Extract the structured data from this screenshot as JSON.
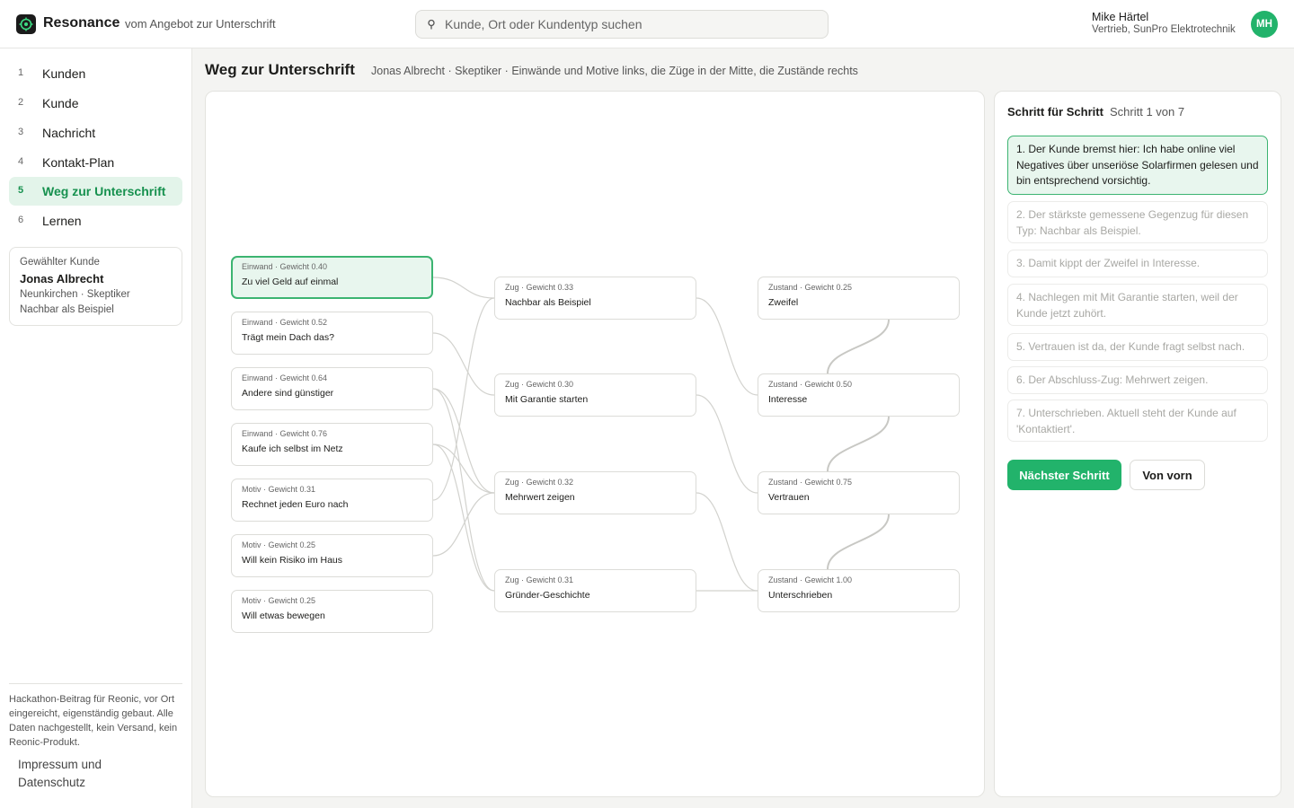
{
  "header": {
    "brand": "Resonance",
    "tagline": "vom Angebot zur Unterschrift",
    "search_placeholder": "Kunde, Ort oder Kundentyp suchen",
    "user_name": "Mike Härtel",
    "user_role": "Vertrieb, SunPro Elektrotechnik",
    "avatar_initials": "MH"
  },
  "sidebar": {
    "items": [
      {
        "num": "1",
        "label": "Kunden"
      },
      {
        "num": "2",
        "label": "Kunde"
      },
      {
        "num": "3",
        "label": "Nachricht"
      },
      {
        "num": "4",
        "label": "Kontakt-Plan"
      },
      {
        "num": "5",
        "label": "Weg zur Unterschrift",
        "active": true
      },
      {
        "num": "6",
        "label": "Lernen"
      }
    ],
    "customer_card": {
      "title": "Gewählter Kunde",
      "name": "Jonas Albrecht",
      "line1": "Neunkirchen · Skeptiker",
      "line2": "Nachbar als Beispiel"
    },
    "footer_note": "Hackathon-Beitrag für Reonic, vor Ort eingereicht, eigenständig gebaut. Alle Daten nachgestellt, kein Versand, kein Reonic-Produkt.",
    "imprint": "Impressum und Datenschutz"
  },
  "main": {
    "title": "Weg zur Unterschrift",
    "subtitle": "Jonas Albrecht · Skeptiker · Einwände und Motive links, die Züge in der Mitte, die Zustände rechts"
  },
  "graph": {
    "columns": [
      [
        {
          "id": "e1",
          "meta": "Einwand · Gewicht 0.40",
          "label": "Zu viel Geld auf einmal",
          "active": true
        },
        {
          "id": "e2",
          "meta": "Einwand · Gewicht 0.52",
          "label": "Trägt mein Dach das?"
        },
        {
          "id": "e3",
          "meta": "Einwand · Gewicht 0.64",
          "label": "Andere sind günstiger"
        },
        {
          "id": "e4",
          "meta": "Einwand · Gewicht 0.76",
          "label": "Kaufe ich selbst im Netz"
        },
        {
          "id": "m1",
          "meta": "Motiv · Gewicht 0.31",
          "label": "Rechnet jeden Euro nach"
        },
        {
          "id": "m2",
          "meta": "Motiv · Gewicht 0.25",
          "label": "Will kein Risiko im Haus"
        },
        {
          "id": "m3",
          "meta": "Motiv · Gewicht 0.25",
          "label": "Will etwas bewegen"
        }
      ],
      [
        {
          "id": "z1",
          "meta": "Zug · Gewicht 0.33",
          "label": "Nachbar als Beispiel"
        },
        {
          "id": "z2",
          "meta": "Zug · Gewicht 0.30",
          "label": "Mit Garantie starten"
        },
        {
          "id": "z3",
          "meta": "Zug · Gewicht 0.32",
          "label": "Mehrwert zeigen"
        },
        {
          "id": "z4",
          "meta": "Zug · Gewicht 0.31",
          "label": "Gründer-Geschichte"
        }
      ],
      [
        {
          "id": "s1",
          "meta": "Zustand · Gewicht 0.25",
          "label": "Zweifel"
        },
        {
          "id": "s2",
          "meta": "Zustand · Gewicht 0.50",
          "label": "Interesse"
        },
        {
          "id": "s3",
          "meta": "Zustand · Gewicht 0.75",
          "label": "Vertrauen"
        },
        {
          "id": "s4",
          "meta": "Zustand · Gewicht 1.00",
          "label": "Unterschrieben"
        }
      ]
    ],
    "edges": [
      [
        "e1",
        "z1"
      ],
      [
        "e2",
        "z2"
      ],
      [
        "e3",
        "z3"
      ],
      [
        "e4",
        "z4"
      ],
      [
        "m1",
        "z1"
      ],
      [
        "m2",
        "z3"
      ],
      [
        "e3",
        "z4"
      ],
      [
        "e4",
        "z3"
      ],
      [
        "z1",
        "s2"
      ],
      [
        "z2",
        "s3"
      ],
      [
        "z3",
        "s4"
      ],
      [
        "z4",
        "s4"
      ],
      [
        "s2",
        "s1"
      ],
      [
        "s3",
        "s2"
      ],
      [
        "s4",
        "s3"
      ]
    ]
  },
  "steps": {
    "title": "Schritt für Schritt",
    "count": "Schritt 1 von 7",
    "items": [
      {
        "text": "1. Der Kunde bremst hier: Ich habe online viel Negatives über unseriöse Solarfirmen gelesen und bin entsprechend vorsichtig.",
        "active": true
      },
      {
        "text": "2. Der stärkste gemessene Gegenzug für diesen Typ: Nachbar als Beispiel."
      },
      {
        "text": "3. Damit kippt der Zweifel in Interesse."
      },
      {
        "text": "4. Nachlegen mit Mit Garantie starten, weil der Kunde jetzt zuhört."
      },
      {
        "text": "5. Vertrauen ist da, der Kunde fragt selbst nach."
      },
      {
        "text": "6. Der Abschluss-Zug: Mehrwert zeigen."
      },
      {
        "text": "7. Unterschrieben. Aktuell steht der Kunde auf 'Kontaktiert'."
      }
    ],
    "next_label": "Nächster Schritt",
    "reset_label": "Von vorn"
  },
  "colors": {
    "accent": "#22b36b",
    "accent_light": "#e8f6ee",
    "edge": "#d2d2ce"
  },
  "icons": {
    "logo": "logo-icon",
    "search": "search-icon"
  }
}
